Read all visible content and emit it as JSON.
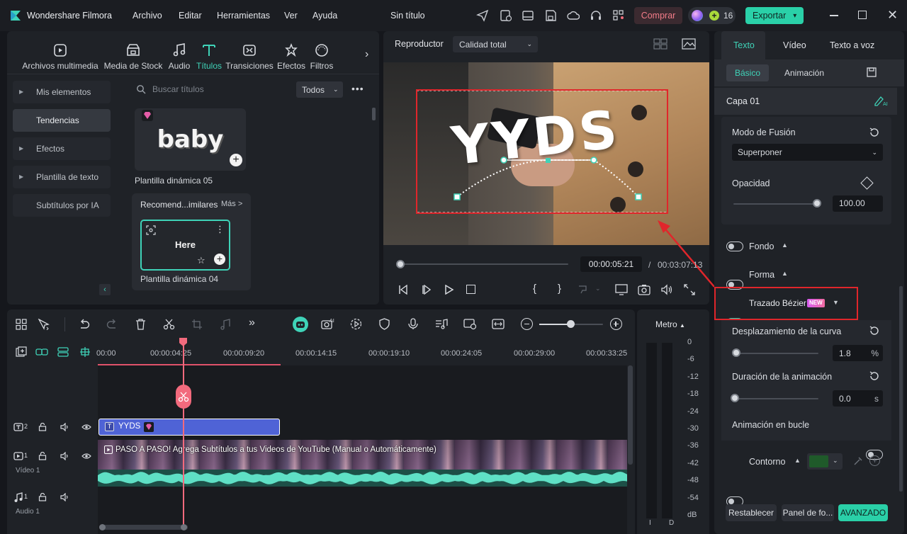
{
  "app": {
    "name": "Wondershare Filmora",
    "project_title": "Sin título",
    "menu": [
      "Archivo",
      "Editar",
      "Herramientas",
      "Ver",
      "Ayuda"
    ],
    "buy_label": "Comprar",
    "credits": "16",
    "export_label": "Exportar"
  },
  "media_tabs": [
    {
      "label": "Archivos multimedia",
      "icon": "media-icon"
    },
    {
      "label": "Media de Stock",
      "icon": "stock-icon"
    },
    {
      "label": "Audio",
      "icon": "music-icon"
    },
    {
      "label": "Títulos",
      "icon": "title-icon"
    },
    {
      "label": "Transiciones",
      "icon": "transition-icon"
    },
    {
      "label": "Efectos",
      "icon": "effects-icon"
    },
    {
      "label": "Filtros",
      "icon": "filters-icon"
    }
  ],
  "sidebar": {
    "items": [
      "Mis elementos",
      "Tendencias",
      "Efectos",
      "Plantilla de texto",
      "Subtítulos por IA"
    ]
  },
  "library": {
    "search_placeholder": "Buscar títulos",
    "filter_value": "Todos",
    "card1_text": "baby",
    "card1_caption": "Plantilla dinámica 05",
    "recommend_title": "Recomend...imilares",
    "recommend_more": "Más >",
    "card2_text": "Here",
    "card2_caption": "Plantilla dinámica 04"
  },
  "player": {
    "label": "Reproductor",
    "quality": "Calidad total",
    "overlay_text": "YYDS",
    "current_time": "00:00:05:21",
    "separator": "/",
    "total_time": "00:03:07:13",
    "progress": 0.02
  },
  "inspector": {
    "tabs": [
      "Texto",
      "Vídeo",
      "Texto a voz"
    ],
    "subtabs": [
      "Básico",
      "Animación"
    ],
    "layer": "Capa 01",
    "blend_label": "Modo de Fusión",
    "blend_value": "Superponer",
    "opacity_label": "Opacidad",
    "opacity_value": "100.00",
    "opacity_fraction": 1.0,
    "fondo_label": "Fondo",
    "forma_label": "Forma",
    "bezier_label": "Trazado Bézier",
    "new_badge": "NEW",
    "curve_label": "Desplazamiento de la curva",
    "curve_value": "1.8",
    "curve_unit": "%",
    "curve_fraction": 0.02,
    "duration_label": "Duración de la animación",
    "duration_value": "0.0",
    "duration_unit": "s",
    "duration_fraction": 0.0,
    "loop_label": "Animación en bucle",
    "contour_label": "Contorno",
    "contour_color": "#1f5a2a",
    "reset_label": "Restablecer",
    "panel_label": "Panel de fo...",
    "advanced_label": "AVANZADO"
  },
  "timeline": {
    "ruler": [
      "00:00",
      "00:00:04:25",
      "00:00:09:20",
      "00:00:14:15",
      "00:00:19:10",
      "00:00:24:05",
      "00:00:29:00",
      "00:00:33:25"
    ],
    "title_clip": "YYDS",
    "video_clip": "PASO A PASO! Agrega Subtítulos a tus Videos de YouTube (Manual o Automáticamente)",
    "track_numbers": [
      "2",
      "1",
      "1"
    ],
    "video_track_label": "Vídeo 1",
    "audio_track_label": "Audio 1"
  },
  "meter": {
    "title": "Metro",
    "ticks": [
      "0",
      "-6",
      "-12",
      "-18",
      "-24",
      "-30",
      "-36",
      "-42",
      "-48",
      "-54",
      "dB"
    ],
    "channels": [
      "I",
      "D"
    ]
  },
  "colors": {
    "accent": "#3fd3b8",
    "buy": "#f06b7a",
    "export_bg": "#2ad0a8",
    "highlight_red": "#e0262b",
    "clip_blue": "#4f63d6"
  }
}
